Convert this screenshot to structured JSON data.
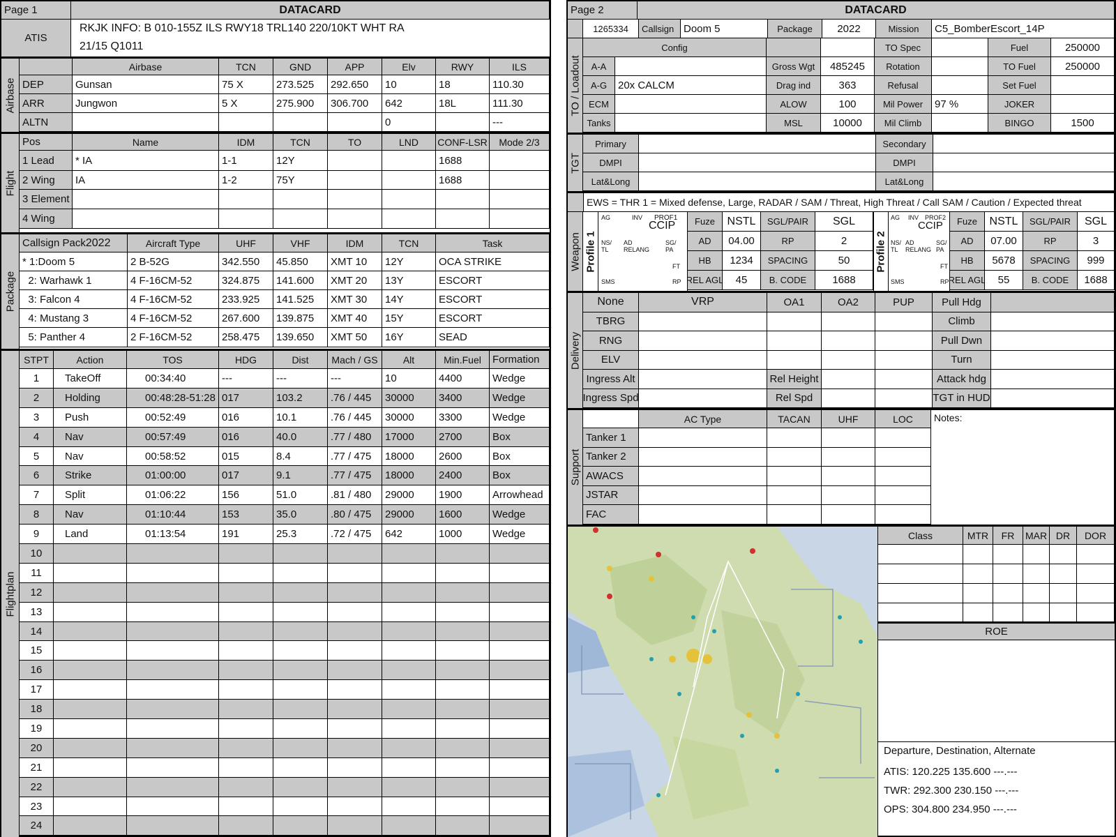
{
  "p1": {
    "page": "Page 1",
    "title": "DATACARD",
    "atis": {
      "label": "ATIS",
      "line1": "RKJK INFO: B 010-155Z ILS RWY18 TRL140 220/10KT WHT RA",
      "line2": "21/15 Q1011"
    },
    "airbase": {
      "label": "Airbase",
      "headers": [
        "Airbase",
        "TCN",
        "GND",
        "APP",
        "Elv",
        "RWY",
        "ILS"
      ],
      "rows": [
        [
          "DEP",
          "Gunsan",
          "75 X",
          "273.525",
          "292.650",
          "10",
          "18",
          "110.30"
        ],
        [
          "ARR",
          "Jungwon",
          "5 X",
          "275.900",
          "306.700",
          "642",
          "18L",
          "111.30"
        ],
        [
          "ALTN",
          "",
          "",
          "",
          "",
          "0",
          "",
          "---"
        ]
      ]
    },
    "flight": {
      "label": "Flight",
      "headers": [
        "Pos",
        "Name",
        "IDM",
        "TCN",
        "TO",
        "LND",
        "CONF-LSR",
        "Mode 2/3"
      ],
      "rows": [
        [
          "1 Lead",
          "* IA",
          "1-1",
          "12Y",
          "",
          "",
          "1688",
          ""
        ],
        [
          "2 Wing",
          "  IA",
          "1-2",
          "75Y",
          "",
          "",
          "1688",
          ""
        ],
        [
          "3 Element",
          "",
          "",
          "",
          "",
          "",
          "",
          ""
        ],
        [
          "4 Wing",
          "",
          "",
          "",
          "",
          "",
          "",
          ""
        ]
      ]
    },
    "package": {
      "label": "Package",
      "callsign_hdr": "Callsign Pack",
      "pack_no": "2022",
      "headers": [
        "Aircraft Type",
        "UHF",
        "VHF",
        "IDM",
        "TCN",
        "Task"
      ],
      "rows": [
        [
          "* 1:Doom 5",
          "2 B-52G",
          "342.550",
          "45.850",
          "XMT 10",
          "12Y",
          "OCA STRIKE"
        ],
        [
          "  2: Warhawk 1",
          "4 F-16CM-52",
          "324.875",
          "141.600",
          "XMT 20",
          "13Y",
          "ESCORT"
        ],
        [
          "  3: Falcon 4",
          "4 F-16CM-52",
          "233.925",
          "141.525",
          "XMT 30",
          "14Y",
          "ESCORT"
        ],
        [
          "  4: Mustang 3",
          "4 F-16CM-52",
          "267.600",
          "139.875",
          "XMT 40",
          "15Y",
          "ESCORT"
        ],
        [
          "  5: Panther 4",
          "2 F-16CM-52",
          "258.475",
          "139.650",
          "XMT 50",
          "16Y",
          "SEAD"
        ]
      ]
    },
    "flightplan": {
      "label": "Flightplan",
      "headers": [
        "STPT",
        "Action",
        "TOS",
        "HDG",
        "Dist",
        "Mach / GS",
        "Alt",
        "Min.Fuel",
        "Formation"
      ],
      "rows": [
        [
          "1",
          "TakeOff",
          "00:34:40",
          "---",
          "---",
          "---",
          "10",
          "4400",
          "Wedge"
        ],
        [
          "2",
          "Holding",
          "00:48:28-51:28",
          "017",
          "103.2",
          ".76 / 445",
          "30000",
          "3400",
          "Wedge"
        ],
        [
          "3",
          "Push",
          "00:52:49",
          "016",
          "10.1",
          ".76 / 445",
          "30000",
          "3300",
          "Wedge"
        ],
        [
          "4",
          "Nav",
          "00:57:49",
          "016",
          "40.0",
          ".77 / 480",
          "17000",
          "2700",
          "Box"
        ],
        [
          "5",
          "Nav",
          "00:58:52",
          "015",
          "8.4",
          ".77 / 475",
          "18000",
          "2600",
          "Box"
        ],
        [
          "6",
          "Strike",
          "01:00:00",
          "017",
          "9.1",
          ".77 / 475",
          "18000",
          "2400",
          "Box"
        ],
        [
          "7",
          "Split",
          "01:06:22",
          "156",
          "51.0",
          ".81 / 480",
          "29000",
          "1900",
          "Arrowhead"
        ],
        [
          "8",
          "Nav",
          "01:10:44",
          "153",
          "35.0",
          ".80 / 475",
          "29000",
          "1600",
          "Wedge"
        ],
        [
          "9",
          "Land",
          "01:13:54",
          "191",
          "25.3",
          ".72 / 475",
          "642",
          "1000",
          "Wedge"
        ],
        [
          "10",
          "",
          "",
          "",
          "",
          "",
          "",
          "",
          ""
        ],
        [
          "11",
          "",
          "",
          "",
          "",
          "",
          "",
          "",
          ""
        ],
        [
          "12",
          "",
          "",
          "",
          "",
          "",
          "",
          "",
          ""
        ],
        [
          "13",
          "",
          "",
          "",
          "",
          "",
          "",
          "",
          ""
        ],
        [
          "14",
          "",
          "",
          "",
          "",
          "",
          "",
          "",
          ""
        ],
        [
          "15",
          "",
          "",
          "",
          "",
          "",
          "",
          "",
          ""
        ],
        [
          "16",
          "",
          "",
          "",
          "",
          "",
          "",
          "",
          ""
        ],
        [
          "17",
          "",
          "",
          "",
          "",
          "",
          "",
          "",
          ""
        ],
        [
          "18",
          "",
          "",
          "",
          "",
          "",
          "",
          "",
          ""
        ],
        [
          "19",
          "",
          "",
          "",
          "",
          "",
          "",
          "",
          ""
        ],
        [
          "20",
          "",
          "",
          "",
          "",
          "",
          "",
          "",
          ""
        ],
        [
          "21",
          "",
          "",
          "",
          "",
          "",
          "",
          "",
          ""
        ],
        [
          "22",
          "",
          "",
          "",
          "",
          "",
          "",
          "",
          ""
        ],
        [
          "23",
          "",
          "",
          "",
          "",
          "",
          "",
          "",
          ""
        ],
        [
          "24",
          "",
          "",
          "",
          "",
          "",
          "",
          "",
          ""
        ]
      ]
    }
  },
  "p2": {
    "page": "Page 2",
    "title": "DATACARD",
    "id": "1265334",
    "callsign_lbl": "Callsign",
    "callsign": "Doom 5",
    "package_lbl": "Package",
    "package": "2022",
    "mission_lbl": "Mission",
    "mission": "C5_BomberEscort_14P",
    "to": {
      "label": "TO / Loadout",
      "config": "Config",
      "tospec": "TO Spec",
      "fuel_lbl": "Fuel",
      "fuel": "250000",
      "aa": "A-A",
      "aa_val": "",
      "gross_lbl": "Gross Wgt",
      "gross": "485245",
      "rotation": "Rotation",
      "tofuel_lbl": "TO Fuel",
      "tofuel": "250000",
      "ag": "A-G",
      "ag_val": "20x CALCM",
      "drag_lbl": "Drag ind",
      "drag": "363",
      "refusal": "Refusal",
      "setfuel": "Set Fuel",
      "ecm": "ECM",
      "alow_lbl": "ALOW",
      "alow": "100",
      "milpower_lbl": "Mil Power",
      "milpower": "97 %",
      "joker": "JOKER",
      "tanks": "Tanks",
      "msl_lbl": "MSL",
      "msl": "10000",
      "milclimb": "Mil Climb",
      "bingo_lbl": "BINGO",
      "bingo": "1500"
    },
    "tgt": {
      "label": "TGT",
      "primary": "Primary",
      "secondary": "Secondary",
      "dmpi": "DMPI",
      "latlong": "Lat&Long"
    },
    "ews": "EWS = THR 1 = Mixed defense, Large, RADAR / SAM / Threat, High Threat / Call SAM / Caution / Expected threat",
    "weapon": {
      "label": "Weapon",
      "prof1": "Profile 1",
      "prof2": "Profile 2",
      "ccip": "CCIP",
      "fuze": "Fuze",
      "nstl": "NSTL",
      "sglpair": "SGL/PAIR",
      "sgl": "SGL",
      "ad": "AD",
      "rp": "RP",
      "hb": "HB",
      "spacing": "SPACING",
      "relagl": "REL AGL",
      "bcode": "B. CODE",
      "p1": {
        "ad": "04.00",
        "rp": "2",
        "hb": "1234",
        "spacing": "50",
        "relagl": "45",
        "bcode": "1688"
      },
      "p2": {
        "ad": "07.00",
        "rp": "3",
        "hb": "5678",
        "spacing": "999",
        "relagl": "55",
        "bcode": "1688"
      },
      "box1": {
        "ag": "AG",
        "inv": "INV",
        "prof": "PROF1",
        "ns": "NS/",
        "tl": "TL",
        "ad": "AD",
        "relang": "RELANG",
        "sg": "SG/",
        "pa": "PA",
        "ft": "FT",
        "sms": "SMS",
        "rp": "RP"
      },
      "box2": {
        "ag": "AG",
        "inv": "INV",
        "prof": "PROF2",
        "ns": "NS/",
        "tl": "TL",
        "ad": "AD",
        "relang": "RELANG",
        "sg": "SG/",
        "pa": "PA",
        "ft": "FT",
        "sms": "SMS",
        "rp": "RP"
      }
    },
    "delivery": {
      "label": "Delivery",
      "none": "None",
      "vrp": "VRP",
      "oa1": "OA1",
      "oa2": "OA2",
      "pup": "PUP",
      "pullhdg": "Pull Hdg",
      "tbrg": "TBRG",
      "climb": "Climb",
      "rng": "RNG",
      "pulldwn": "Pull Dwn",
      "elv": "ELV",
      "turn": "Turn",
      "ingalt": "Ingress Alt",
      "relheight": "Rel Height",
      "atkhdg": "Attack hdg",
      "ingspd": "Ingress Spd",
      "relspd": "Rel Spd",
      "tgthud": "TGT in HUD"
    },
    "support": {
      "label": "Support",
      "actype": "AC Type",
      "tacan": "TACAN",
      "uhf": "UHF",
      "loc": "LOC",
      "notes": "Notes:",
      "rows": [
        "Tanker 1",
        "Tanker 2",
        "AWACS",
        "JSTAR",
        "FAC"
      ]
    },
    "class": {
      "headers": [
        "Class",
        "MTR",
        "FR",
        "MAR",
        "DR",
        "DOR"
      ]
    },
    "roe": "ROE",
    "freq": {
      "title": "Departure, Destination, Alternate",
      "atis": "ATIS: 120.225  135.600  ---.---",
      "twr": "TWR: 292.300  230.150  ---.---",
      "ops": "OPS: 304.800  234.950  ---.---"
    }
  }
}
